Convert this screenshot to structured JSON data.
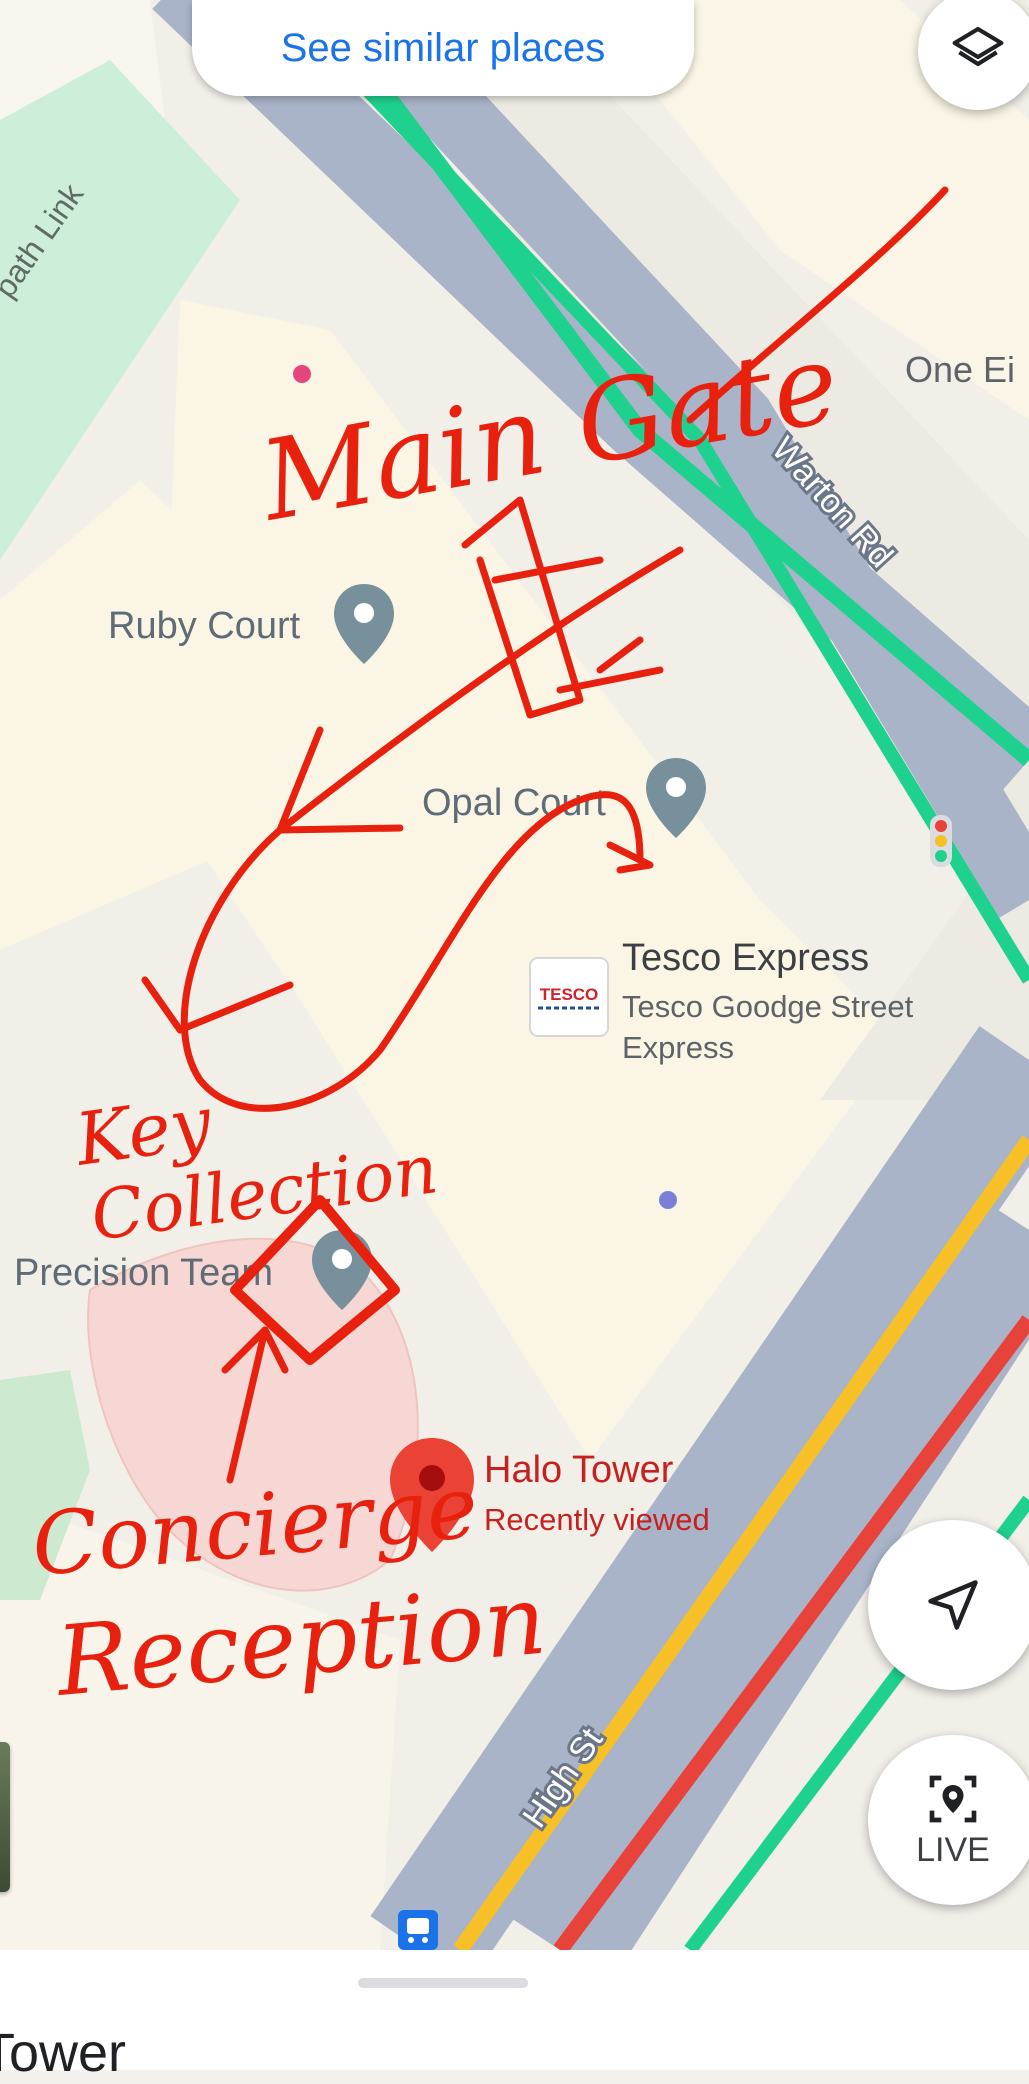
{
  "top_chip": {
    "label": "See similar places"
  },
  "layers_button": {
    "icon": "layers-icon"
  },
  "map": {
    "streets": [
      {
        "name": "Warton Rd"
      },
      {
        "name": "High St"
      },
      {
        "name": "path Link"
      }
    ],
    "places": [
      {
        "name": "Ruby Court",
        "icon": "place-pin-icon"
      },
      {
        "name": "Opal Court",
        "icon": "place-pin-icon"
      },
      {
        "name": "Precision Team",
        "icon": "place-pin-icon"
      },
      {
        "name": "One Ei",
        "icon": ""
      }
    ],
    "tesco": {
      "logo_text": "TESCO",
      "name": "Tesco Express",
      "subtitle_line1": "Tesco Goodge Street",
      "subtitle_line2": "Express"
    },
    "selected_place": {
      "name": "Halo Tower",
      "status": "Recently viewed",
      "color": "#ea4335"
    },
    "colors": {
      "road_traffic_green": "#1fd18e",
      "road_traffic_yellow": "#f6c026",
      "road_traffic_red": "#e8433a",
      "road_gray": "#a9b4c8",
      "annotation_red": "#e8210f"
    }
  },
  "annotations": {
    "main_gate": "Main Gate",
    "key_collection_line1": "Key",
    "key_collection_line2": "Collection",
    "concierge": "Concierge",
    "reception": "Reception"
  },
  "buttons": {
    "navigate": {
      "icon": "navigation-arrow-icon"
    },
    "live": {
      "label": "LIVE",
      "icon": "live-view-icon"
    }
  },
  "bottom_sheet": {
    "title": "Tower"
  }
}
